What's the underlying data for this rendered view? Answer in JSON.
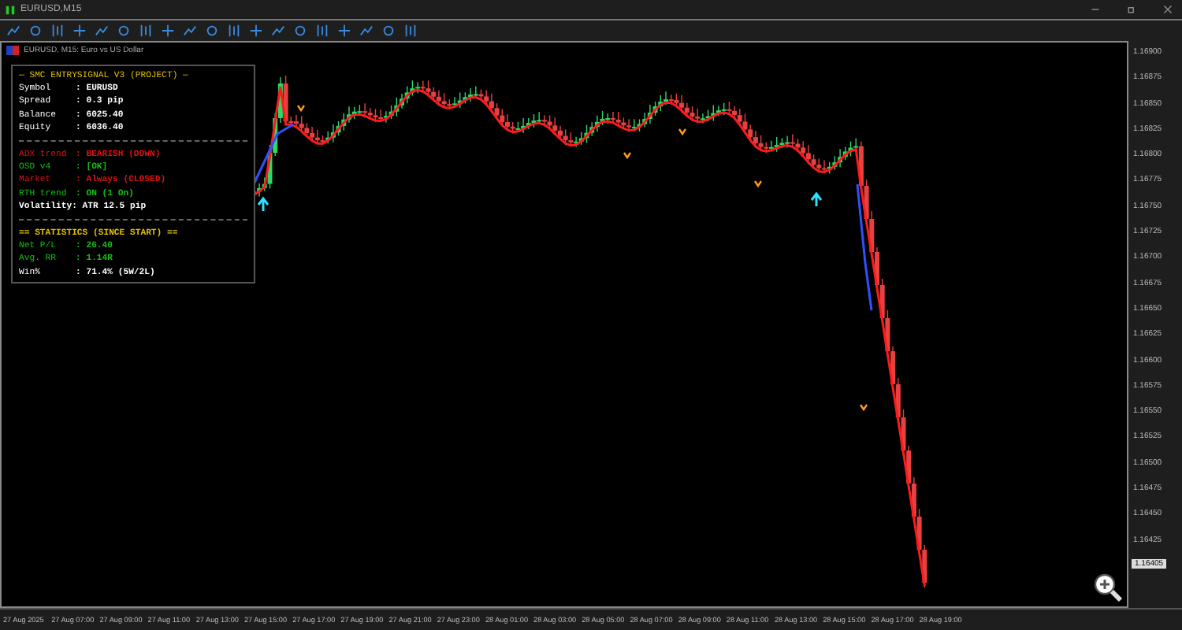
{
  "window": {
    "title": "EURUSD,M15"
  },
  "chart": {
    "label": "EURUSD, M15:  Euro vs US Dollar"
  },
  "panel": {
    "title": "— SMC ENTRYSIGNAL V3 (PROJECT) —",
    "rows": [
      {
        "kind": "pair",
        "label": "Symbol",
        "value": ": EURUSD",
        "color": "#ffffff"
      },
      {
        "kind": "pair",
        "label": "Spread",
        "value": ": 0.3 pip",
        "color": "#ffffff"
      },
      {
        "kind": "pair",
        "label": "Balance",
        "value": ": 6025.40",
        "color": "#ffffff"
      },
      {
        "kind": "pair",
        "label": "Equity",
        "value": ": 6036.40",
        "color": "#ffffff"
      },
      {
        "kind": "rule"
      },
      {
        "kind": "pair",
        "label": "ADX trend",
        "value": ": BEARISH (DOWN)",
        "color": "#e01010"
      },
      {
        "kind": "pair",
        "label": "OSD v4",
        "value": ": [OK]",
        "color": "#10c010"
      },
      {
        "kind": "pair",
        "label": "Market",
        "value": ": Always (CLOSED)",
        "color": "#e01010"
      },
      {
        "kind": "pair",
        "label": "RTH trend",
        "value": ": ON (1 On)",
        "color": "#10c010"
      },
      {
        "kind": "line",
        "text": "Volatility: ATR 12.5 pip",
        "color": "#ffffff"
      },
      {
        "kind": "rule"
      },
      {
        "kind": "line",
        "text": "== STATISTICS (SINCE START) ==",
        "color": "#e0c000"
      },
      {
        "kind": "pair",
        "label": "Net P/L",
        "value": ": 26.40",
        "color": "#10c010"
      },
      {
        "kind": "pair",
        "label": "Avg. RR",
        "value": ": 1.14R",
        "color": "#10c010"
      },
      {
        "kind": "pair",
        "label": "Win%",
        "value": ": 71.4% (5W/2L)",
        "color": "#ffffff"
      }
    ]
  },
  "price_axis": [
    "1.16900",
    "1.16875",
    "1.16850",
    "1.16825",
    "1.16800",
    "1.16775",
    "1.16750",
    "1.16725",
    "1.16700",
    "1.16675",
    "1.16650",
    "1.16625",
    "1.16600",
    "1.16575",
    "1.16550",
    "1.16525",
    "1.16500",
    "1.16475",
    "1.16450",
    "1.16425"
  ],
  "price_tag": "1.16405",
  "time_axis": [
    "27 Aug 2025",
    "27 Aug 07:00",
    "27 Aug 09:00",
    "27 Aug 11:00",
    "27 Aug 13:00",
    "27 Aug 15:00",
    "27 Aug 17:00",
    "27 Aug 19:00",
    "27 Aug 21:00",
    "27 Aug 23:00",
    "28 Aug 01:00",
    "28 Aug 03:00",
    "28 Aug 05:00",
    "28 Aug 07:00",
    "28 Aug 09:00",
    "28 Aug 11:00",
    "28 Aug 13:00",
    "28 Aug 15:00",
    "28 Aug 17:00",
    "28 Aug 19:00"
  ]
}
